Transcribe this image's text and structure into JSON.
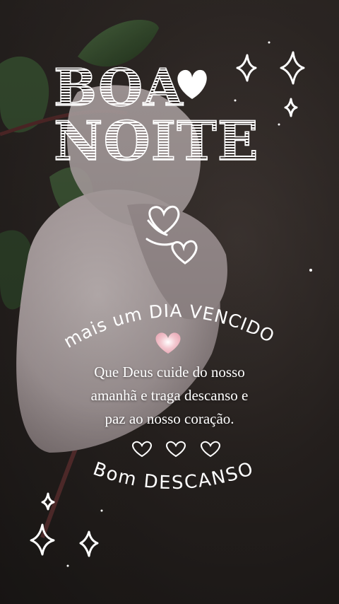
{
  "title": {
    "line1": "BOA",
    "line2": "NOITE"
  },
  "arc_top": "mais um DIA VENCIDO",
  "message": [
    "Que Deus cuide do nosso",
    "amanhã e traga descanso e",
    "paz ao nosso coração."
  ],
  "arc_bottom": "Bom DESCANSO",
  "colors": {
    "text": "#ffffff",
    "petal": "#d9cccd",
    "leaf": "#3f5a3a",
    "background": "#2f2927",
    "glow_heart": "#f3c7cf"
  }
}
